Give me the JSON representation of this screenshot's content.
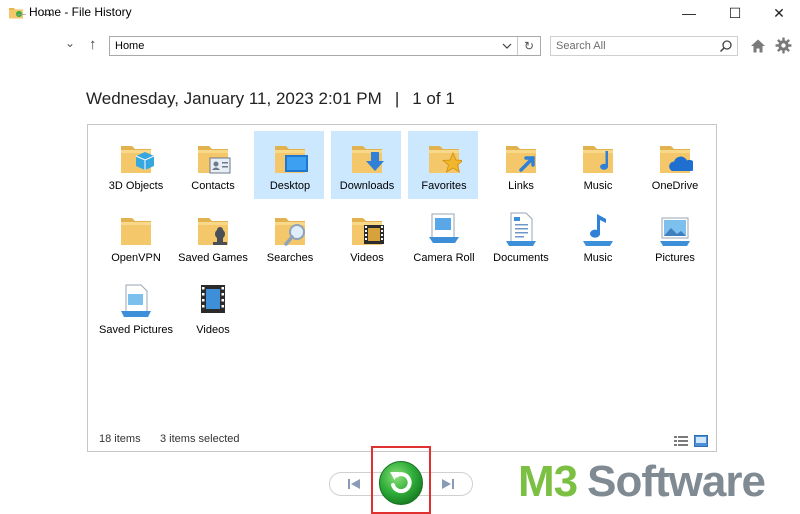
{
  "window": {
    "title": "Home - File History",
    "minimize": "—",
    "maximize": "☐",
    "close": "✕"
  },
  "nav": {
    "back_icon": "←",
    "forward_icon": "→",
    "recent_icon": "⌄",
    "up_icon": "↑",
    "address": "Home",
    "refresh_icon": "↻",
    "search_placeholder": "Search All"
  },
  "header": {
    "date": "Wednesday, January 11, 2023 2:01 PM",
    "separator": "|",
    "position": "1 of 1"
  },
  "items": [
    {
      "label": "3D Objects",
      "icon": "3d-objects-folder-icon",
      "selected": false
    },
    {
      "label": "Contacts",
      "icon": "contacts-folder-icon",
      "selected": false
    },
    {
      "label": "Desktop",
      "icon": "desktop-folder-icon",
      "selected": true
    },
    {
      "label": "Downloads",
      "icon": "downloads-folder-icon",
      "selected": true
    },
    {
      "label": "Favorites",
      "icon": "favorites-folder-icon",
      "selected": true
    },
    {
      "label": "Links",
      "icon": "links-folder-icon",
      "selected": false
    },
    {
      "label": "Music",
      "icon": "music-folder-icon",
      "selected": false
    },
    {
      "label": "OneDrive",
      "icon": "onedrive-folder-icon",
      "selected": false
    },
    {
      "label": "OpenVPN",
      "icon": "folder-icon",
      "selected": false
    },
    {
      "label": "Saved Games",
      "icon": "saved-games-folder-icon",
      "selected": false
    },
    {
      "label": "Searches",
      "icon": "searches-folder-icon",
      "selected": false
    },
    {
      "label": "Videos",
      "icon": "videos-folder-icon",
      "selected": false
    },
    {
      "label": "Camera Roll",
      "icon": "camera-roll-icon",
      "selected": false
    },
    {
      "label": "Documents",
      "icon": "documents-icon",
      "selected": false
    },
    {
      "label": "Music",
      "icon": "music-library-icon",
      "selected": false
    },
    {
      "label": "Pictures",
      "icon": "pictures-icon",
      "selected": false
    },
    {
      "label": "Saved Pictures",
      "icon": "saved-pictures-icon",
      "selected": false
    },
    {
      "label": "Videos",
      "icon": "videos-library-icon",
      "selected": false
    }
  ],
  "status": {
    "count": "18 items",
    "selected": "3 items selected"
  },
  "brand": {
    "part1": "M3",
    "part2": "Software"
  },
  "colors": {
    "folder": "#f4c76a",
    "selection": "#cce8ff",
    "restore_green": "#2fae3a",
    "highlight_red": "#e03030",
    "brand_green": "#7cc043",
    "brand_gray": "#7f8a92"
  }
}
